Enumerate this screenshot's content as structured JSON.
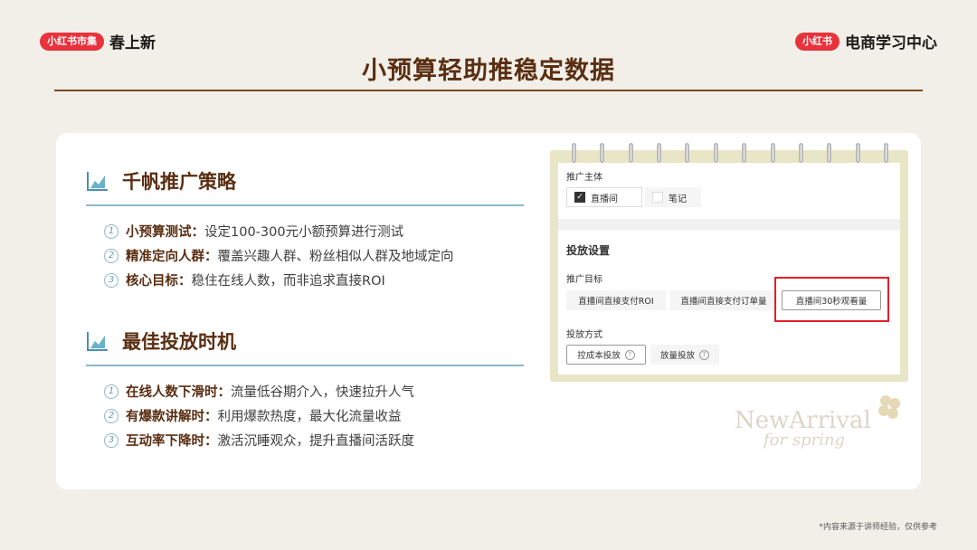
{
  "header": {
    "left_logo": "小红书市集",
    "left_text": "春上新",
    "right_logo": "小红书",
    "right_text": "电商学习中心"
  },
  "title": "小预算轻助推稳定数据",
  "sections": [
    {
      "title": "千帆推广策略",
      "items": [
        {
          "num": "1",
          "key": "小预算测试：",
          "text": "设定100-300元小额预算进行测试"
        },
        {
          "num": "2",
          "key": "精准定向人群：",
          "text": "覆盖兴趣人群、粉丝相似人群及地域定向"
        },
        {
          "num": "3",
          "key": "核心目标：",
          "text": "稳住在线人数，而非追求直接ROI"
        }
      ]
    },
    {
      "title": "最佳投放时机",
      "items": [
        {
          "num": "1",
          "key": "在线人数下滑时：",
          "text": "流量低谷期介入，快速拉升人气"
        },
        {
          "num": "2",
          "key": "有爆款讲解时：",
          "text": "利用爆款热度，最大化流量收益"
        },
        {
          "num": "3",
          "key": "互动率下降时：",
          "text": "激活沉睡观众，提升直播间活跃度"
        }
      ]
    }
  ],
  "panel": {
    "promo_subject_label": "推广主体",
    "subject_live": "直播间",
    "subject_note": "笔记",
    "delivery_settings": "投放设置",
    "goal_label": "推广目标",
    "goal_1": "直播间直接支付ROI",
    "goal_2": "直播间直接支付订单量",
    "goal_3": "直播间30秒观看量",
    "method_label": "投放方式",
    "method_1": "控成本投放",
    "method_2": "放量投放",
    "help_glyph": "?",
    "check_glyph": "✓"
  },
  "decoration": {
    "line1": "NewArrival",
    "line2": "for spring"
  },
  "footnote": "*内容来源于讲师经验，仅供参考",
  "colors": {
    "accent_red": "#e8323c",
    "title_brown": "#5a2e12",
    "rule_blue": "#8ab8c8",
    "highlight_red": "#e0202a"
  }
}
